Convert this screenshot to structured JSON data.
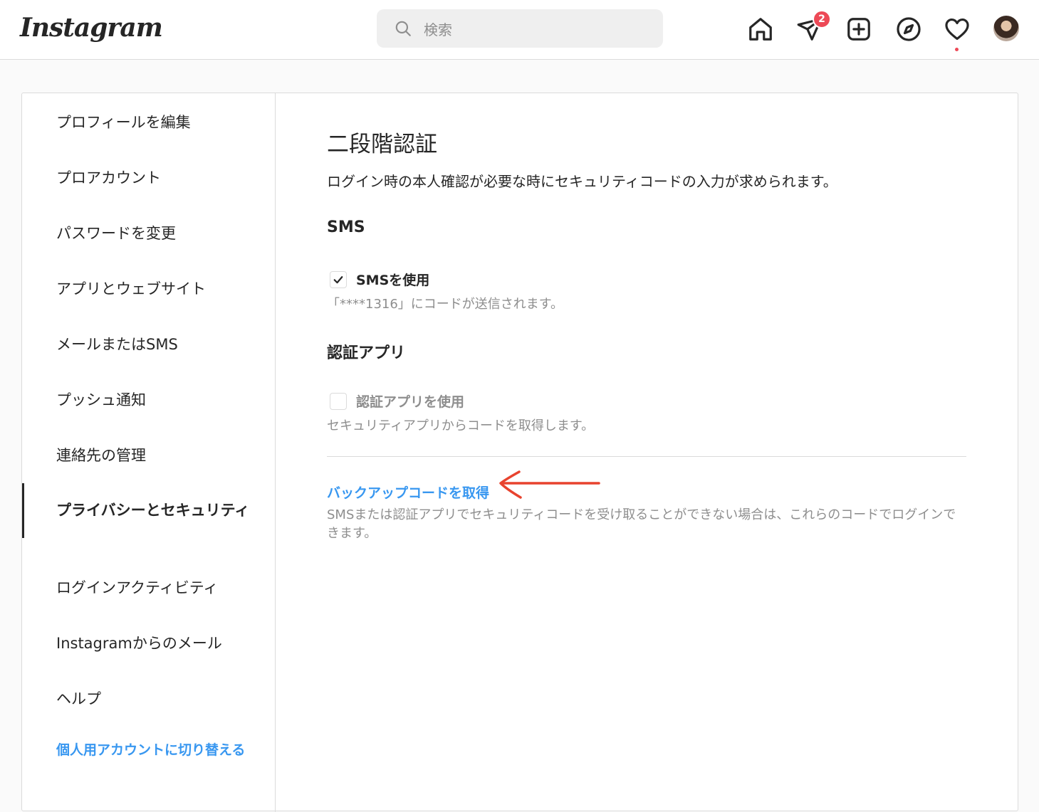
{
  "header": {
    "logo": "Instagram",
    "search_placeholder": "検索",
    "direct_badge_count": "2"
  },
  "sidebar": {
    "items": [
      {
        "label": "プロフィールを編集"
      },
      {
        "label": "プロアカウント"
      },
      {
        "label": "パスワードを変更"
      },
      {
        "label": "アプリとウェブサイト"
      },
      {
        "label": "メールまたはSMS"
      },
      {
        "label": "プッシュ通知"
      },
      {
        "label": "連絡先の管理"
      },
      {
        "label": "プライバシーとセキュリティ"
      },
      {
        "label": "ログインアクティビティ"
      },
      {
        "label": "Instagramからのメール"
      },
      {
        "label": "ヘルプ"
      }
    ],
    "active_item": "プライバシーとセキュリティ",
    "switch_link": "個人用アカウントに切り替える"
  },
  "main": {
    "title": "二段階認証",
    "subtitle": "ログイン時の本人確認が必要な時にセキュリティコードの入力が求められます。",
    "sms": {
      "heading": "SMS",
      "checkbox_label": "SMSを使用",
      "checked": true,
      "help": "「****1316」にコードが送信されます。"
    },
    "auth_app": {
      "heading": "認証アプリ",
      "checkbox_label": "認証アプリを使用",
      "checked": false,
      "help": "セキュリティアプリからコードを取得します。"
    },
    "backup": {
      "link": "バックアップコードを取得",
      "help": "SMSまたは認証アプリでセキュリティコードを受け取ることができない場合は、これらのコードでログインできます。"
    }
  },
  "colors": {
    "link_blue": "#3897f0",
    "badge_red": "#ed4956",
    "annotation_arrow": "#e8432e"
  }
}
